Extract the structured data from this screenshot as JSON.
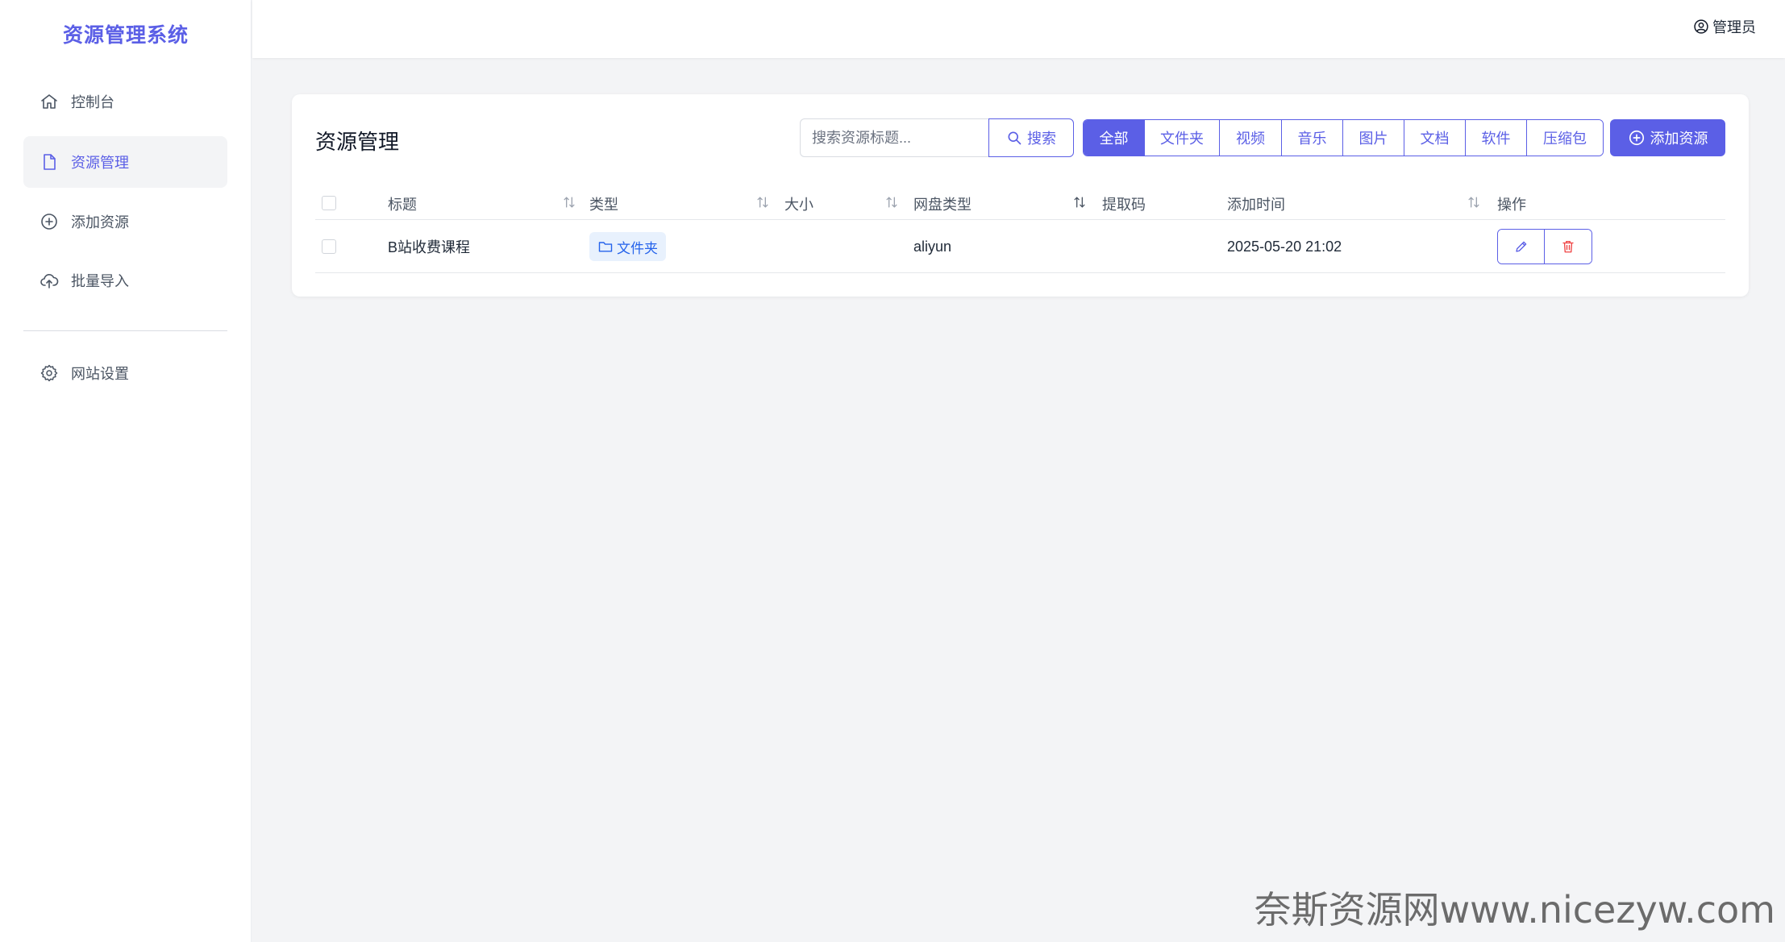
{
  "app": {
    "title": "资源管理系统"
  },
  "sidebar": {
    "items": [
      {
        "label": "控制台",
        "icon": "home-icon"
      },
      {
        "label": "资源管理",
        "icon": "file-icon",
        "active": true
      },
      {
        "label": "添加资源",
        "icon": "plus-circle-icon"
      },
      {
        "label": "批量导入",
        "icon": "cloud-upload-icon"
      },
      {
        "label": "网站设置",
        "icon": "gear-icon"
      }
    ]
  },
  "header": {
    "user_label": "管理员",
    "user_icon": "user-circle-icon"
  },
  "main": {
    "title": "资源管理",
    "search": {
      "placeholder": "搜索资源标题...",
      "value": "",
      "button_label": "搜索"
    },
    "filters": [
      "全部",
      "文件夹",
      "视频",
      "音乐",
      "图片",
      "文档",
      "软件",
      "压缩包"
    ],
    "active_filter": "全部",
    "add_button_label": "添加资源",
    "table": {
      "columns": [
        "标题",
        "类型",
        "大小",
        "网盘类型",
        "提取码",
        "添加时间",
        "操作"
      ],
      "rows": [
        {
          "title": "B站收费课程",
          "type": "文件夹",
          "size": "",
          "disk_type": "aliyun",
          "code": "",
          "added_at": "2025-05-20 21:02"
        }
      ]
    }
  },
  "watermark": "奈斯资源网www.nicezyw.com",
  "colors": {
    "accent": "#5b5fe6",
    "tag_bg": "#e8f1fd",
    "tag_text": "#2563eb",
    "danger": "#ef4444"
  }
}
